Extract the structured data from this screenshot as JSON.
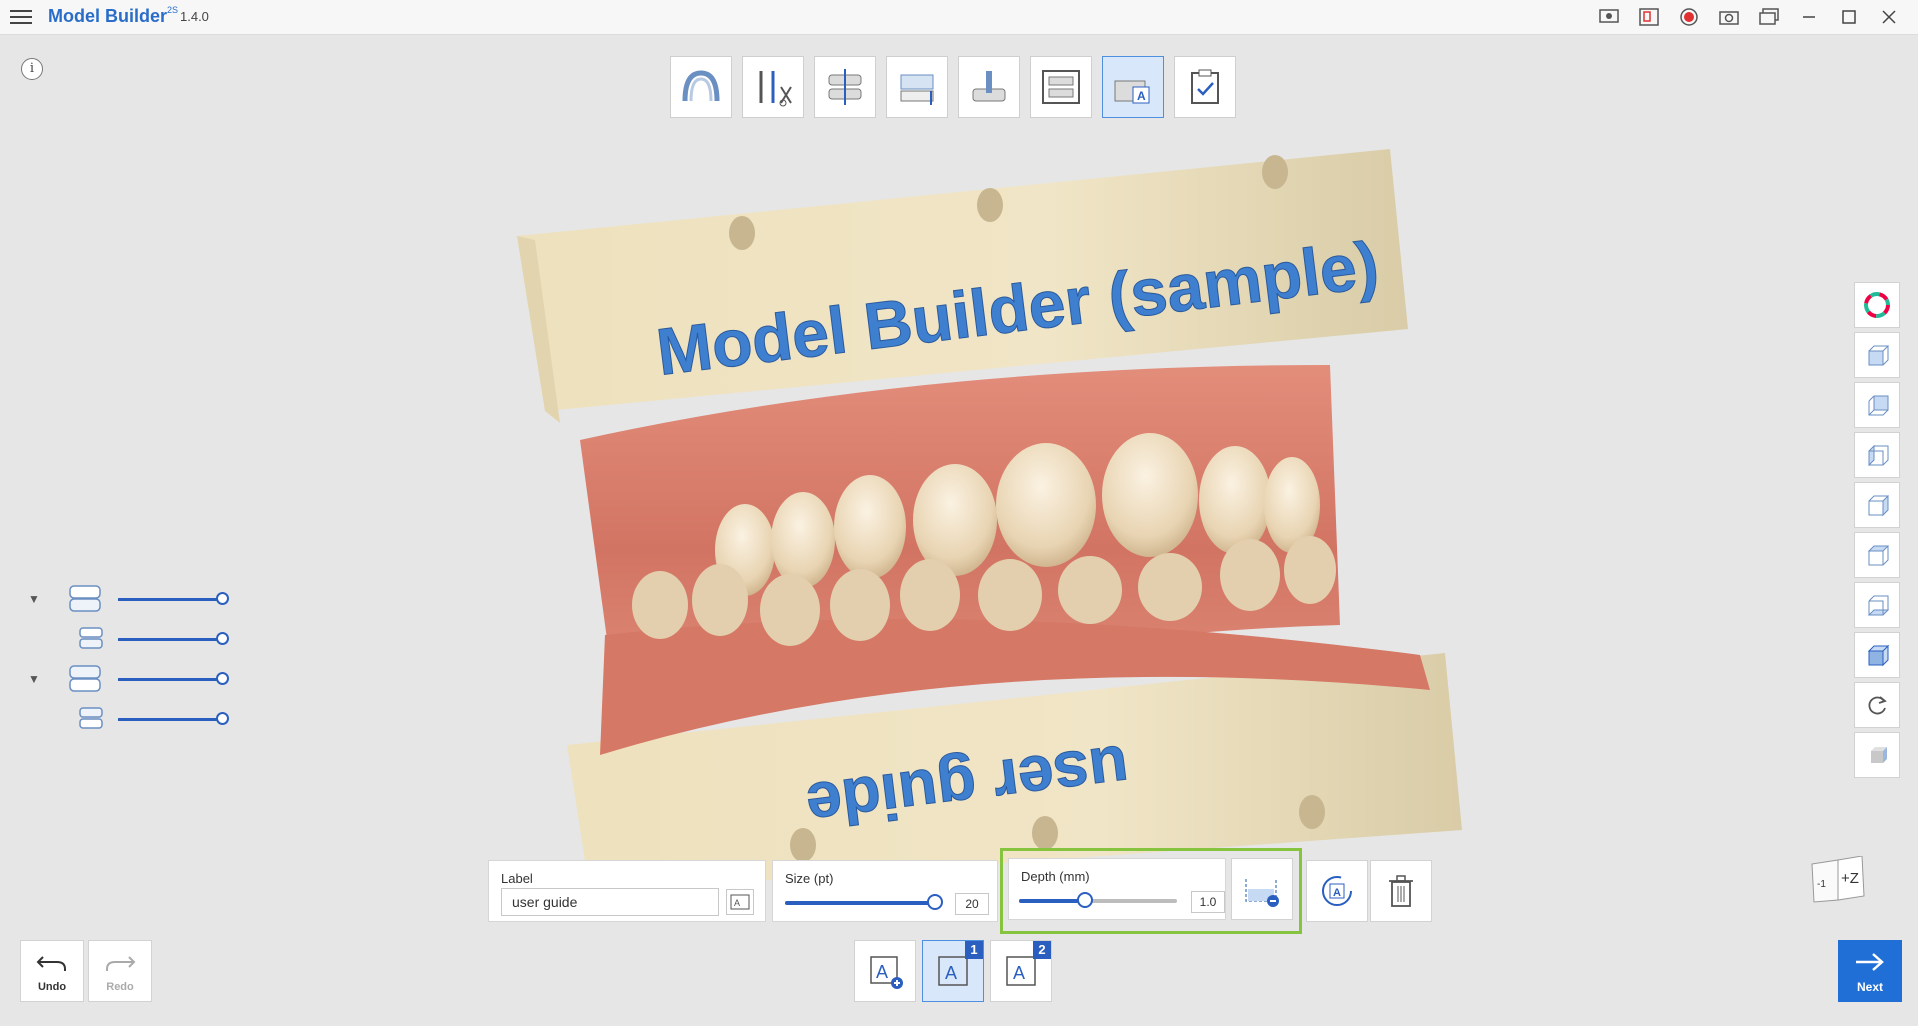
{
  "app": {
    "title": "Model Builder",
    "superscript": "2S",
    "version": "1.4.0"
  },
  "info_glyph": "i",
  "model_text": {
    "top": "Model Builder (sample)",
    "bottom": "user guide"
  },
  "label_panel": {
    "label": "Label",
    "value": "user guide"
  },
  "size_panel": {
    "label": "Size (pt)",
    "value": "20",
    "fraction": 1.0
  },
  "depth_panel": {
    "label": "Depth (mm)",
    "value": "1.0",
    "fraction": 0.42
  },
  "label_tabs": [
    {
      "badge": ""
    },
    {
      "badge": "1"
    },
    {
      "badge": "2"
    }
  ],
  "undo": {
    "label": "Undo"
  },
  "redo": {
    "label": "Redo"
  },
  "next": {
    "label": "Next"
  },
  "axis_widget": {
    "left": "-1",
    "right": "+Z"
  },
  "icon_glyph": "A",
  "colors": {
    "accent": "#2a5fc0",
    "highlight": "#86c440",
    "next": "#1f6fd6"
  }
}
